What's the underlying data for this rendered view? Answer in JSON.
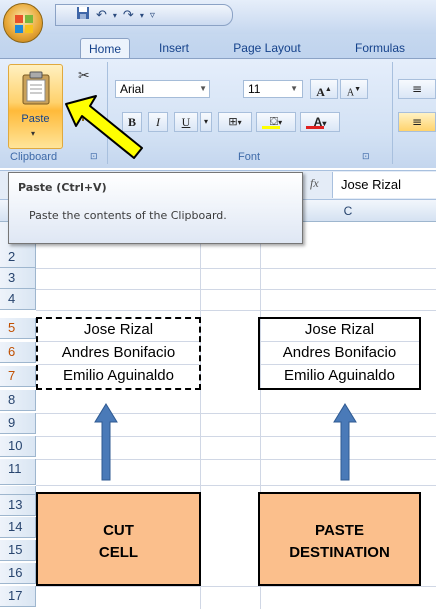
{
  "quick_access": {
    "save_icon": "save-icon",
    "undo_icon": "undo-icon",
    "redo_icon": "redo-icon"
  },
  "tabs": [
    {
      "label": "Home",
      "active": true
    },
    {
      "label": "Insert"
    },
    {
      "label": "Page Layout"
    },
    {
      "label": "Formulas"
    }
  ],
  "clipboard": {
    "paste_label": "Paste",
    "group_label": "Clipboard"
  },
  "font": {
    "name": "Arial",
    "size": "11",
    "group_label": "Font",
    "bold": "B",
    "italic": "I",
    "underline": "U",
    "grow": "A",
    "shrink": "A",
    "color": "A"
  },
  "tooltip": {
    "title": "Paste (Ctrl+V)",
    "body": "Paste the contents of the Clipboard."
  },
  "formula_bar": {
    "fx": "fx",
    "value": "Jose Rizal"
  },
  "grid": {
    "column_c": "C",
    "rows": [
      "2",
      "3",
      "4",
      "5",
      "6",
      "7",
      "8",
      "9",
      "10",
      "11",
      "13",
      "14",
      "15",
      "16",
      "17"
    ]
  },
  "cut_range": [
    "Jose Rizal",
    "Andres Bonifacio",
    "Emilio Aguinaldo"
  ],
  "dest_range": [
    "Jose Rizal",
    "Andres Bonifacio",
    "Emilio Aguinaldo"
  ],
  "labels": {
    "cut_line1": "CUT",
    "cut_line2": "CELL",
    "paste_line1": "PASTE",
    "paste_line2": "DESTINATION"
  },
  "colors": {
    "box_fill": "#fbbf8c",
    "arrow": "#4a7ab8",
    "pointer_arrow": "#ffff00"
  }
}
